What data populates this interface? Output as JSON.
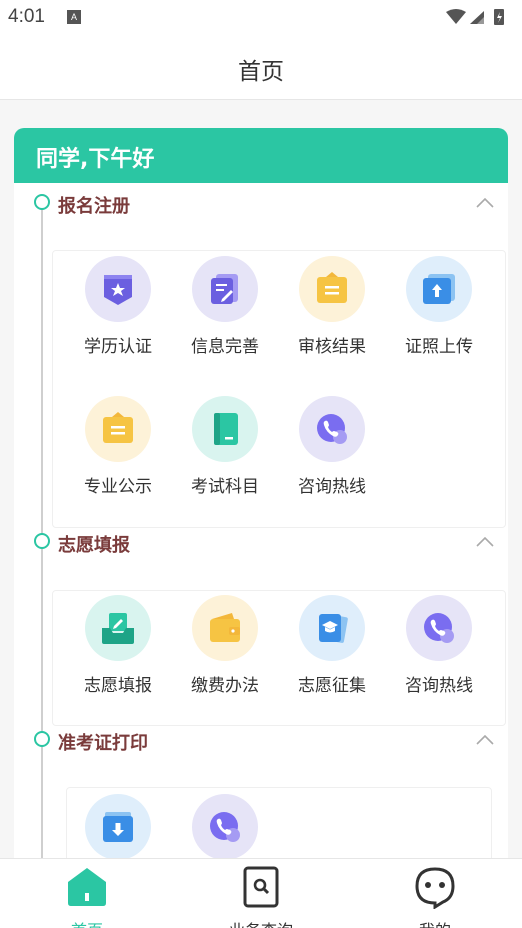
{
  "status_bar": {
    "time": "4:01",
    "notification_icon": "A"
  },
  "header": {
    "title": "首页"
  },
  "greeting": "同学,下午好",
  "colors": {
    "accent": "#2bc6a3",
    "section_title": "#7a3b3b"
  },
  "sections": [
    {
      "title": "报名注册",
      "items": [
        {
          "label": "学历认证",
          "icon": "badge-icon"
        },
        {
          "label": "信息完善",
          "icon": "edit-doc-icon"
        },
        {
          "label": "审核结果",
          "icon": "folder-icon"
        },
        {
          "label": "证照上传",
          "icon": "upload-icon"
        },
        {
          "label": "专业公示",
          "icon": "folder-icon"
        },
        {
          "label": "考试科目",
          "icon": "book-icon"
        },
        {
          "label": "咨询热线",
          "icon": "phone-icon"
        }
      ]
    },
    {
      "title": "志愿填报",
      "items": [
        {
          "label": "志愿填报",
          "icon": "inbox-icon"
        },
        {
          "label": "缴费办法",
          "icon": "wallet-icon"
        },
        {
          "label": "志愿征集",
          "icon": "graduation-book-icon"
        },
        {
          "label": "咨询热线",
          "icon": "phone-icon"
        }
      ]
    },
    {
      "title": "准考证打印",
      "items": [
        {
          "label": "",
          "icon": "download-icon"
        },
        {
          "label": "",
          "icon": "phone-icon"
        }
      ]
    }
  ],
  "tabs": [
    {
      "label": "首页",
      "icon": "home-icon",
      "active": true
    },
    {
      "label": "业务查询",
      "icon": "search-doc-icon",
      "active": false
    },
    {
      "label": "我的",
      "icon": "face-icon",
      "active": false
    }
  ]
}
